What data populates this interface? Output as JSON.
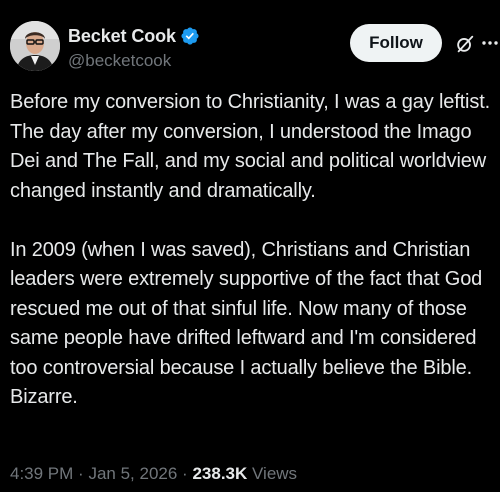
{
  "author": {
    "display_name": "Becket Cook",
    "handle": "@becketcook",
    "verified": true
  },
  "actions": {
    "follow_label": "Follow",
    "grok_icon": "grok-icon",
    "more_icon": "more-options-icon"
  },
  "post": {
    "paragraphs": [
      "Before my conversion to Christianity, I was a gay leftist. The day after my conversion, I understood the Imago Dei and The Fall, and my social and political worldview changed instantly and dramatically.",
      "In 2009 (when I was saved), Christians and Christian leaders were extremely supportive of the fact that God rescued me out of that sinful life. Now many of those same people have drifted leftward and I'm considered too controversial because I actually believe the Bible. Bizarre."
    ],
    "time": "4:39 PM",
    "separator": "·",
    "date": "Jan 5, 2026",
    "views_count": "238.3K",
    "views_label": "Views"
  },
  "colors": {
    "background": "#000000",
    "text_primary": "#e7e9ea",
    "text_secondary": "#71767b",
    "verified_badge": "#1d9bf0",
    "follow_button_bg": "#eff3f4"
  }
}
